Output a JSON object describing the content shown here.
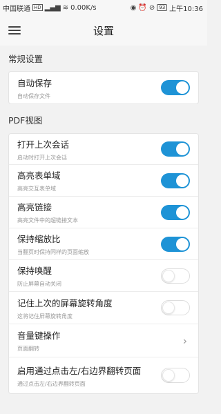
{
  "status_bar": {
    "carrier": "中国联通",
    "network_label": "HD",
    "signal": "4G",
    "speed": "0.00K/s",
    "battery": "93",
    "time": "上午10:36"
  },
  "app_bar": {
    "title": "设置"
  },
  "sections": [
    {
      "title": "常规设置",
      "items": [
        {
          "title": "自动保存",
          "subtitle": "自动保存文件",
          "control": "toggle",
          "on": true
        }
      ]
    },
    {
      "title": "PDF视图",
      "items": [
        {
          "title": "打开上次会话",
          "subtitle": "启动时打开上次会话",
          "control": "toggle",
          "on": true
        },
        {
          "title": "高亮表单域",
          "subtitle": "高亮交互表单域",
          "control": "toggle",
          "on": true
        },
        {
          "title": "高亮链接",
          "subtitle": "高亮文件中的超链接文本",
          "control": "toggle",
          "on": true
        },
        {
          "title": "保持缩放比",
          "subtitle": "当翻页时保持同样的页面缩放",
          "control": "toggle",
          "on": true
        },
        {
          "title": "保持唤醒",
          "subtitle": "防止屏幕自动关闭",
          "control": "toggle",
          "on": false
        },
        {
          "title": "记住上次的屏幕旋转角度",
          "subtitle": "这将记住屏幕旋转角度",
          "control": "toggle",
          "on": false
        },
        {
          "title": "音量键操作",
          "subtitle": "页面翻转",
          "control": "chevron"
        },
        {
          "title": "启用通过点击左/右边界翻转页面",
          "subtitle": "通过点击左/右边界翻转页面",
          "control": "toggle",
          "on": false
        }
      ]
    }
  ],
  "colors": {
    "accent": "#1e93d6",
    "background": "#f2f2f2"
  }
}
